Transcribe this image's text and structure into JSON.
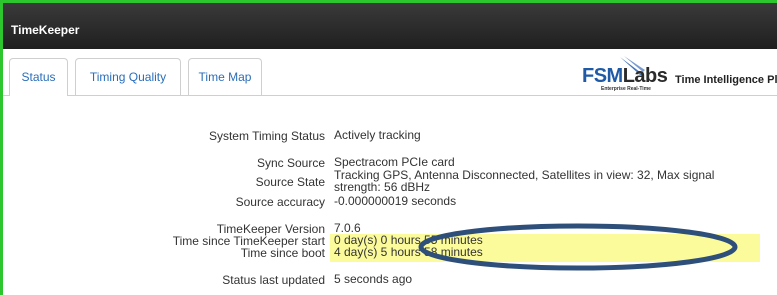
{
  "app": {
    "title": "TimeKeeper"
  },
  "tabs": [
    {
      "label": "Status",
      "active": true
    },
    {
      "label": "Timing Quality",
      "active": false
    },
    {
      "label": "Time Map",
      "active": false
    }
  ],
  "brand": {
    "logo_fsm": "FSM",
    "logo_labs": "Labs",
    "tagline": "Enterprise Real-Time",
    "platform_text": "Time Intelligence Platform"
  },
  "status": {
    "system_timing_status": {
      "label": "System Timing Status",
      "value": "Actively tracking"
    },
    "sync_source": {
      "label": "Sync Source",
      "value": "Spectracom PCIe card"
    },
    "source_state": {
      "label": "Source State",
      "value": "Tracking GPS, Antenna Disconnected, Satellites in view: 32, Max signal strength: 56 dBHz"
    },
    "source_accuracy": {
      "label": "Source accuracy",
      "value": "-0.000000019 seconds"
    },
    "version": {
      "label": "TimeKeeper Version",
      "value": "7.0.6"
    },
    "since_start": {
      "label": "Time since TimeKeeper start",
      "value": "0 day(s) 0 hours 55 minutes"
    },
    "since_boot": {
      "label": "Time since boot",
      "value": "4 day(s) 5 hours 58 minutes"
    },
    "last_updated": {
      "label": "Status last updated",
      "value": "5 seconds ago"
    }
  },
  "colors": {
    "accent_border": "#2ec62e",
    "link": "#2a6eb8",
    "highlight": "#fbfb9c",
    "annotation_ellipse": "#2e4f7a"
  }
}
